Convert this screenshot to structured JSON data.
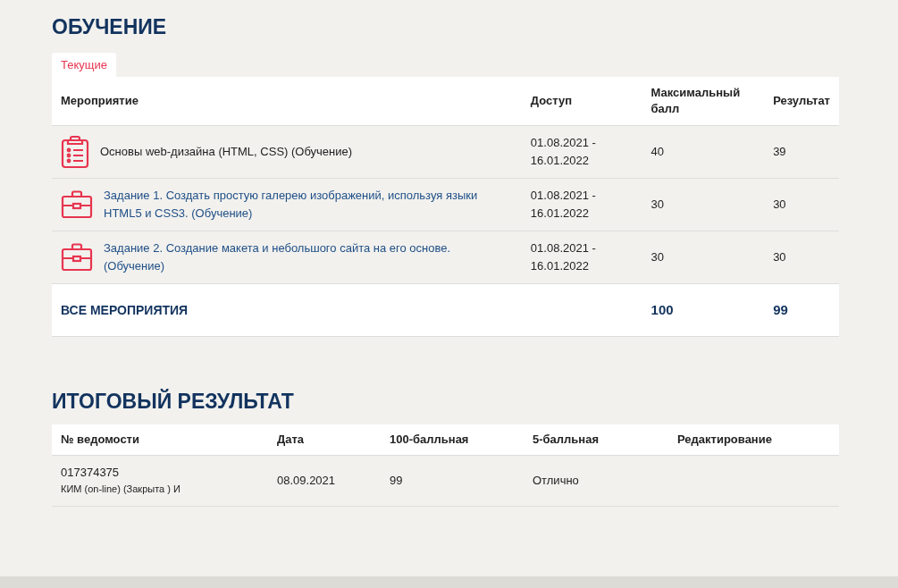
{
  "training": {
    "title": "ОБУЧЕНИЕ",
    "tabs": [
      {
        "label": "Текущие",
        "selected": true
      }
    ],
    "columns": [
      "Мероприятие",
      "Доступ",
      "Максимальный балл",
      "Результат"
    ],
    "rows": [
      {
        "kind": "test",
        "name": "Основы web-дизайна (HTML, CSS) (Обучение)",
        "access": "01.08.2021 - 16.01.2022",
        "max": "40",
        "result": "39"
      },
      {
        "kind": "task",
        "name": "Задание 1. Создать простую галерею изображений, используя языки HTML5 и CSS3. (Обучение)",
        "access": "01.08.2021 - 16.01.2022",
        "max": "30",
        "result": "30"
      },
      {
        "kind": "task",
        "name": "Задание 2. Создание макета и небольшого сайта на его основе. (Обучение)",
        "access": "01.08.2021 - 16.01.2022",
        "max": "30",
        "result": "30"
      }
    ],
    "total": {
      "label": "ВСЕ МЕРОПРИЯТИЯ",
      "max": "100",
      "result": "99"
    }
  },
  "final": {
    "title": "ИТОГОВЫЙ РЕЗУЛЬТАТ",
    "columns": [
      "№ ведомости",
      "Дата",
      "100-балльная",
      "5-балльная",
      "Редактирование"
    ],
    "rows": [
      {
        "number": "017374375",
        "note": "КИМ (on-line) (Закрыта ) И",
        "date": "08.09.2021",
        "score100": "99",
        "score5": "Отлично"
      }
    ]
  }
}
